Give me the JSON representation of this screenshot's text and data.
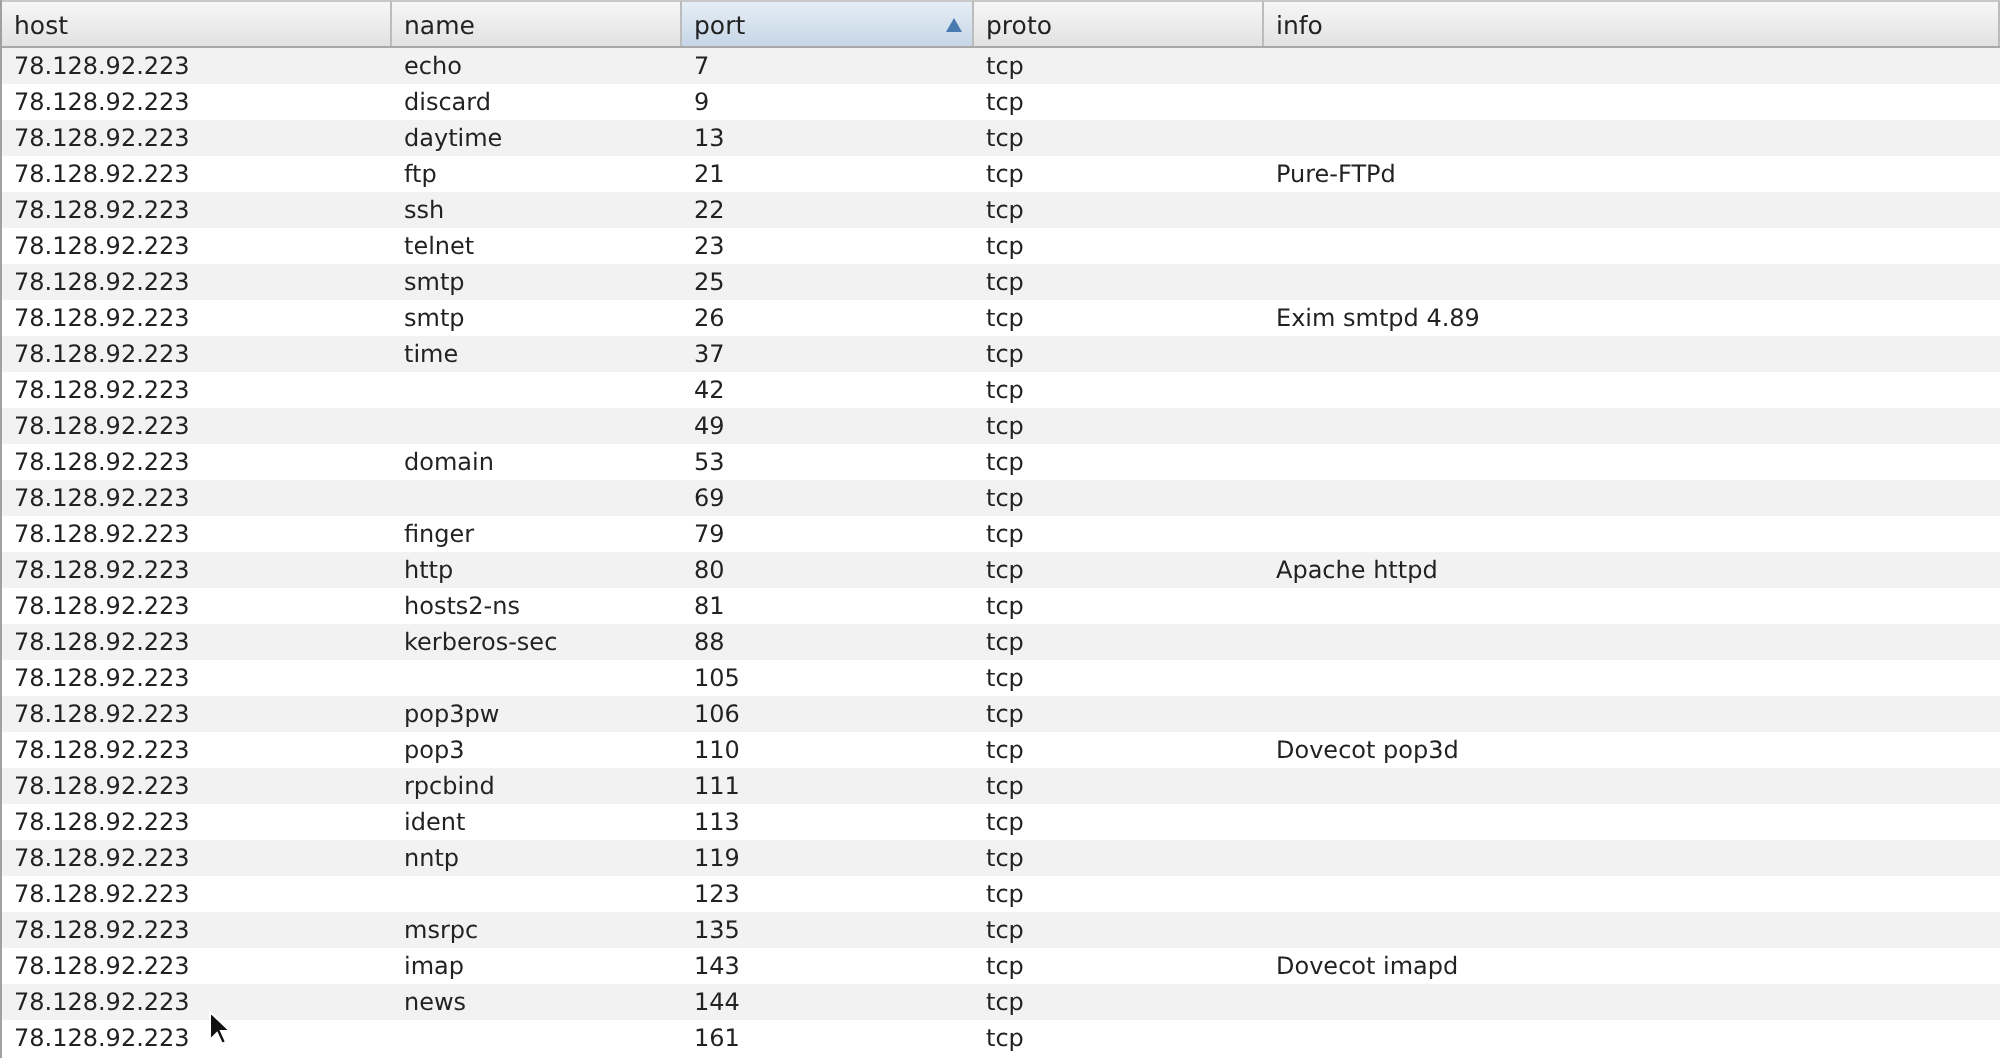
{
  "table": {
    "columns": [
      {
        "label": "host",
        "sorted": false
      },
      {
        "label": "name",
        "sorted": false
      },
      {
        "label": "port",
        "sorted": true
      },
      {
        "label": "proto",
        "sorted": false
      },
      {
        "label": "info",
        "sorted": false
      }
    ],
    "rows": [
      [
        "78.128.92.223",
        "echo",
        "7",
        "tcp",
        ""
      ],
      [
        "78.128.92.223",
        "discard",
        "9",
        "tcp",
        ""
      ],
      [
        "78.128.92.223",
        "daytime",
        "13",
        "tcp",
        ""
      ],
      [
        "78.128.92.223",
        "ftp",
        "21",
        "tcp",
        "Pure-FTPd"
      ],
      [
        "78.128.92.223",
        "ssh",
        "22",
        "tcp",
        ""
      ],
      [
        "78.128.92.223",
        "telnet",
        "23",
        "tcp",
        ""
      ],
      [
        "78.128.92.223",
        "smtp",
        "25",
        "tcp",
        ""
      ],
      [
        "78.128.92.223",
        "smtp",
        "26",
        "tcp",
        "Exim smtpd 4.89"
      ],
      [
        "78.128.92.223",
        "time",
        "37",
        "tcp",
        ""
      ],
      [
        "78.128.92.223",
        "",
        "42",
        "tcp",
        ""
      ],
      [
        "78.128.92.223",
        "",
        "49",
        "tcp",
        ""
      ],
      [
        "78.128.92.223",
        "domain",
        "53",
        "tcp",
        ""
      ],
      [
        "78.128.92.223",
        "",
        "69",
        "tcp",
        ""
      ],
      [
        "78.128.92.223",
        "finger",
        "79",
        "tcp",
        ""
      ],
      [
        "78.128.92.223",
        "http",
        "80",
        "tcp",
        "Apache httpd"
      ],
      [
        "78.128.92.223",
        "hosts2-ns",
        "81",
        "tcp",
        ""
      ],
      [
        "78.128.92.223",
        "kerberos-sec",
        "88",
        "tcp",
        ""
      ],
      [
        "78.128.92.223",
        "",
        "105",
        "tcp",
        ""
      ],
      [
        "78.128.92.223",
        "pop3pw",
        "106",
        "tcp",
        ""
      ],
      [
        "78.128.92.223",
        "pop3",
        "110",
        "tcp",
        "Dovecot pop3d"
      ],
      [
        "78.128.92.223",
        "rpcbind",
        "111",
        "tcp",
        ""
      ],
      [
        "78.128.92.223",
        "ident",
        "113",
        "tcp",
        ""
      ],
      [
        "78.128.92.223",
        "nntp",
        "119",
        "tcp",
        ""
      ],
      [
        "78.128.92.223",
        "",
        "123",
        "tcp",
        ""
      ],
      [
        "78.128.92.223",
        "msrpc",
        "135",
        "tcp",
        ""
      ],
      [
        "78.128.92.223",
        "imap",
        "143",
        "tcp",
        "Dovecot imapd"
      ],
      [
        "78.128.92.223",
        "news",
        "144",
        "tcp",
        ""
      ],
      [
        "78.128.92.223",
        "",
        "161",
        "tcp",
        ""
      ]
    ]
  }
}
